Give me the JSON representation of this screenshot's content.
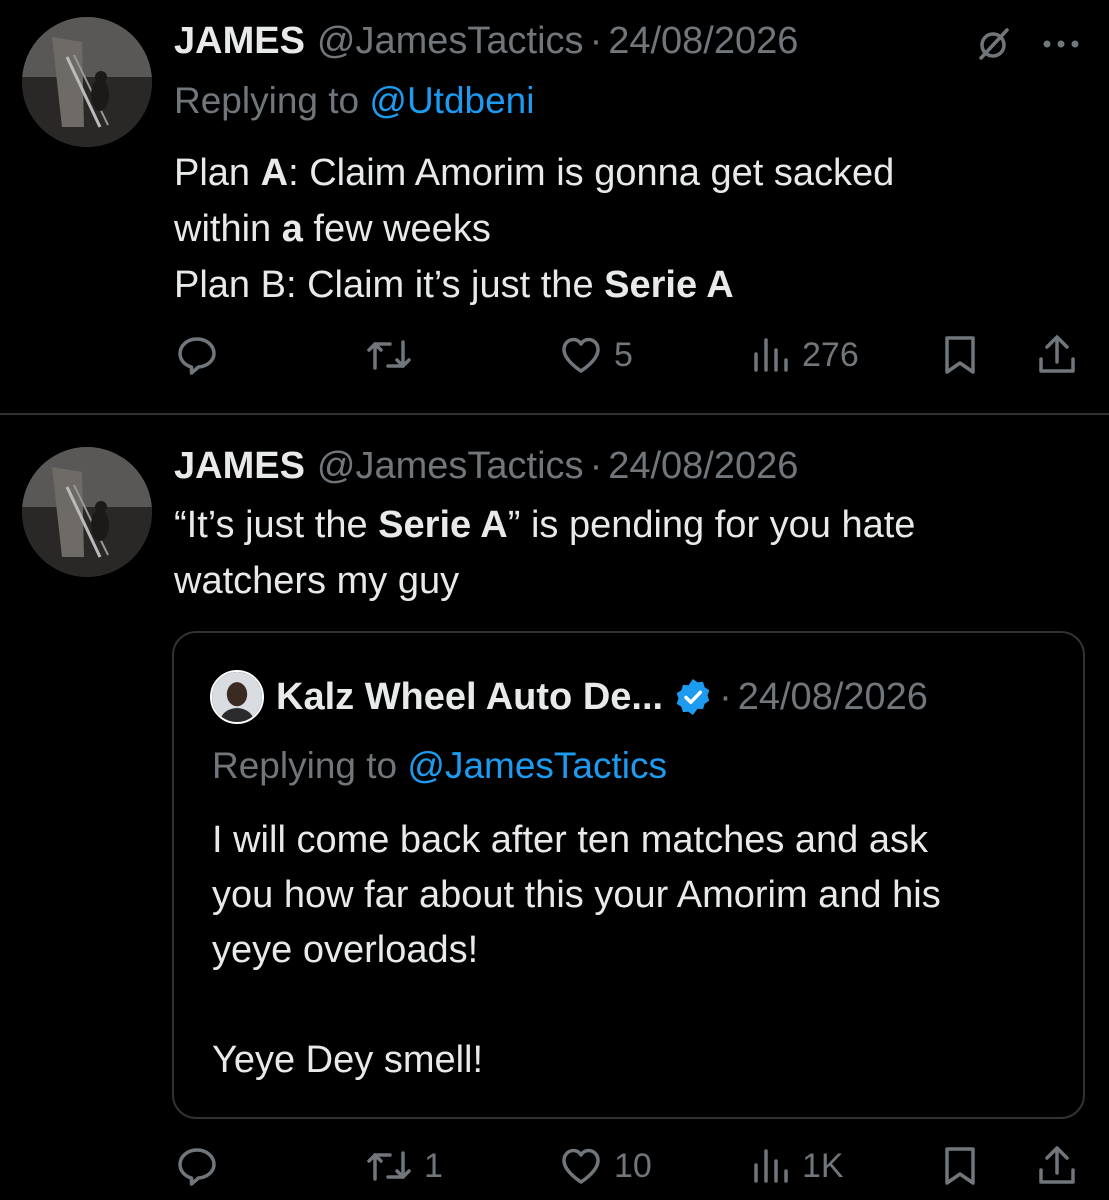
{
  "tweet1": {
    "name": "JAMES",
    "handle": "@JamesTactics",
    "dot": "·",
    "date": "24/08/2026",
    "replying_prefix": "Replying to ",
    "replying_handle": "@Utdbeni",
    "line1": {
      "a": "Plan ",
      "b": "A",
      "c": ": Claim Amorim is gonna get sacked"
    },
    "line2": {
      "a": "within ",
      "b": "a",
      "c": " few weeks"
    },
    "line3": {
      "a": "Plan B: Claim it’s just the ",
      "b": "Serie A"
    },
    "likes": "5",
    "views": "276",
    "retweets": ""
  },
  "tweet2": {
    "name": "JAMES",
    "handle": "@JamesTactics",
    "dot": "·",
    "date": "24/08/2026",
    "line1": {
      "a": "“It’s just the ",
      "b": "Serie A",
      "c": "” is pending for you hate"
    },
    "line2": "watchers my guy",
    "retweets": "1",
    "likes": "10",
    "views": "1K",
    "quote": {
      "name": "Kalz Wheel Auto De...",
      "dot": "·",
      "date": "24/08/2026",
      "replying_prefix": "Replying to ",
      "replying_handle": "@JamesTactics",
      "line1": "I will come back after ten matches and ask",
      "line2": "you how far about this your Amorim and his",
      "line3": "yeye overloads!",
      "line4": "Yeye Dey smell!"
    }
  },
  "icons": {
    "reply": "reply-bubble-icon",
    "retweet": "retweet-icon",
    "like": "heart-icon",
    "views": "views-bars-icon",
    "bookmark": "bookmark-icon",
    "share": "share-icon",
    "grok": "grok-slash-icon",
    "more": "more-dots-icon",
    "verified": "verified-badge-icon"
  },
  "colors": {
    "background": "#000000",
    "text": "#e7e9ea",
    "muted": "#71767b",
    "link": "#1d9bf0",
    "border": "#2f3336"
  }
}
